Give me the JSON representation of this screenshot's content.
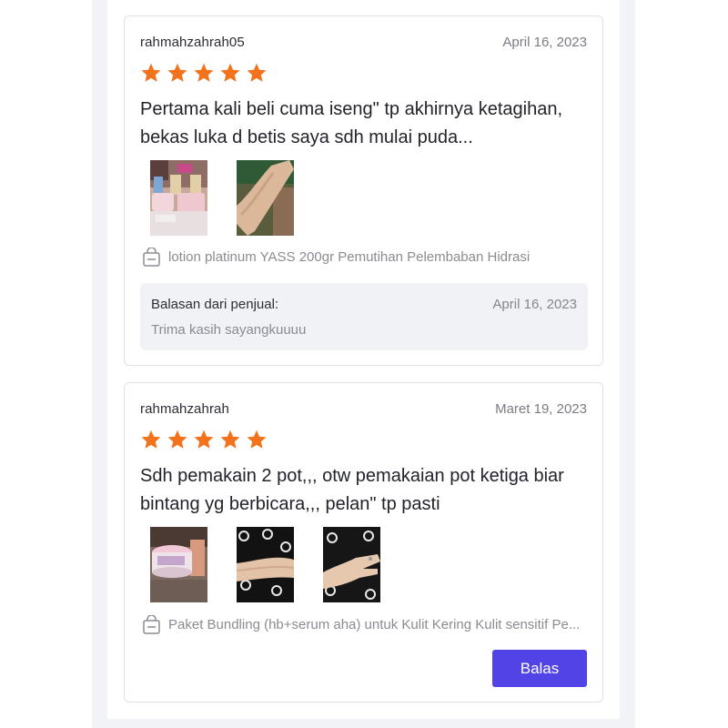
{
  "colors": {
    "star": "#f2731c",
    "accent_button": "#5143e6",
    "card_border": "#dfe1e6",
    "reply_background": "#f1f2f6"
  },
  "reviews": [
    {
      "username": "rahmahzahrah05",
      "date": "April 16, 2023",
      "rating": 5,
      "text": "Pertama kali beli cuma iseng\" tp akhirnya ketagihan, bekas luka d betis saya sdh mulai puda...",
      "photo_count": 2,
      "product_icon": "shopping-bag-icon",
      "product": "lotion platinum YASS 200gr Pemutihan Pelembaban Hidrasi",
      "seller_reply": {
        "title": "Balasan dari penjual:",
        "date": "April 16, 2023",
        "text": "Trima kasih sayangkuuuu"
      }
    },
    {
      "username": "rahmahzahrah",
      "date": "Maret 19, 2023",
      "rating": 5,
      "text": "Sdh pemakain 2 pot,,, otw pemakaian pot ketiga biar bintang yg berbicara,,, pelan\" tp pasti",
      "photo_count": 3,
      "product_icon": "shopping-bag-icon",
      "product": "Paket Bundling (hb+serum aha) untuk Kulit Kering Kulit sensitif Pe...",
      "reply_button_label": "Balas"
    }
  ]
}
